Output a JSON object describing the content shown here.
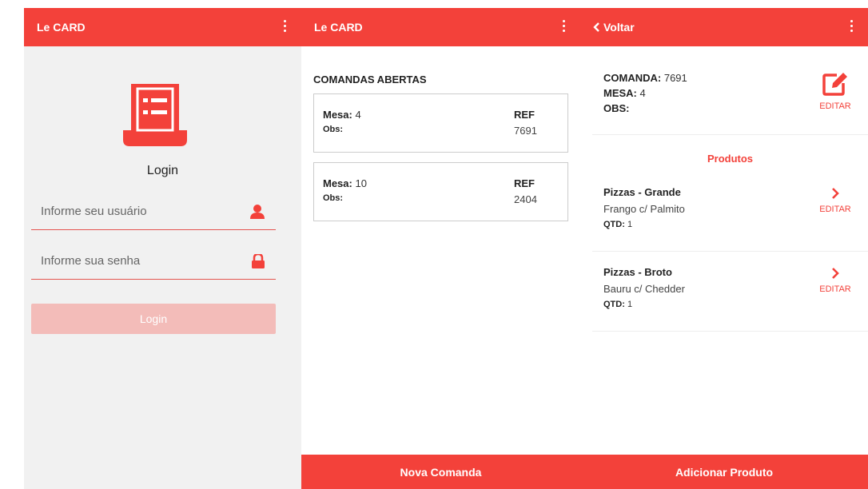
{
  "colors": {
    "accent": "#f3413a",
    "login_disabled": "#f3bcb9"
  },
  "login": {
    "app_title": "Le CARD",
    "heading": "Login",
    "user_placeholder": "Informe seu usuário",
    "pass_placeholder": "Informe sua senha",
    "button_label": "Login",
    "icons": {
      "logo": "receipt-list-icon",
      "user": "user-icon",
      "pass": "lock-icon",
      "menu": "kebab-menu-icon"
    }
  },
  "comandas": {
    "app_title": "Le CARD",
    "section_title": "COMANDAS ABERTAS",
    "mesa_label": "Mesa:",
    "obs_label": "Obs:",
    "ref_label": "REF",
    "items": [
      {
        "mesa": "4",
        "ref": "7691"
      },
      {
        "mesa": "10",
        "ref": "2404"
      }
    ],
    "bottom_button": "Nova Comanda"
  },
  "detalhe": {
    "back_label": "Voltar",
    "comanda_label": "COMANDA:",
    "comanda_value": "7691",
    "mesa_label": "MESA:",
    "mesa_value": "4",
    "obs_label": "OBS:",
    "edit_label": "EDITAR",
    "produtos_title": "Produtos",
    "qtd_label": "QTD:",
    "products": [
      {
        "name": "Pizzas - Grande",
        "flavor": "Frango c/ Palmito",
        "qtd": "1"
      },
      {
        "name": "Pizzas - Broto",
        "flavor": "Bauru c/ Chedder",
        "qtd": "1"
      }
    ],
    "bottom_button": "Adicionar Produto",
    "icons": {
      "back": "chevron-left-icon",
      "edit": "edit-icon",
      "product": "chevron-right-icon"
    }
  }
}
